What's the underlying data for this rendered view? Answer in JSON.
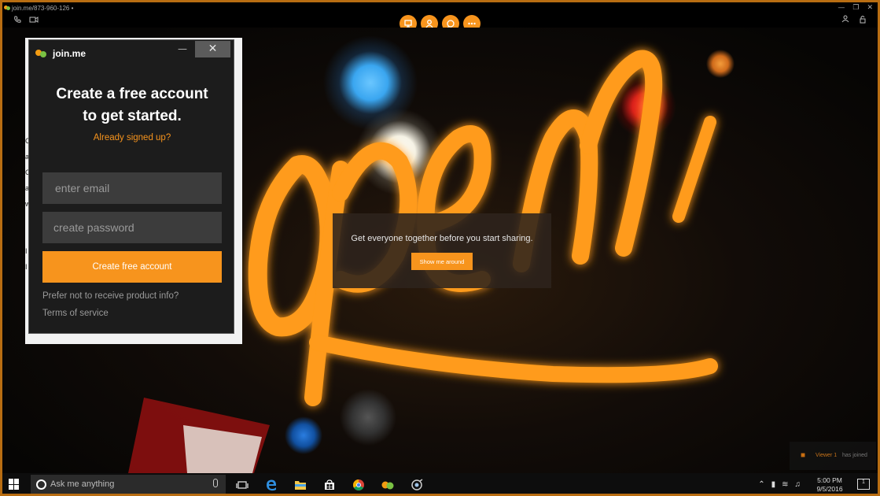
{
  "titlebar": {
    "meeting": "join.me/873-960-126 •"
  },
  "toolbar": {
    "left_icons": [
      "phone-icon",
      "video-icon"
    ],
    "center_icons": [
      "screen-share-icon",
      "people-icon",
      "chat-icon",
      "more-icon"
    ],
    "right_icons": [
      "person-icon",
      "lock-icon"
    ]
  },
  "strip_letters": [
    "C",
    "a",
    "C",
    "a",
    "w",
    "",
    "",
    "I",
    "I"
  ],
  "dialog": {
    "brand": "join.me",
    "close_label": "✕",
    "minimize_label": "—",
    "title_line1": "Create a free account",
    "title_line2": "to get started.",
    "already_signed": "Already signed up?",
    "email_placeholder": "enter email",
    "password_placeholder": "create password",
    "create_button": "Create free account",
    "prefer_not": "Prefer not to receive product info?",
    "terms": "Terms of service"
  },
  "overlay": {
    "message": "Get everyone together before you start sharing.",
    "button": "Show me around"
  },
  "viewer_notice": {
    "name": "Viewer 1",
    "rest": "has joined"
  },
  "taskbar": {
    "search_placeholder": "Ask me anything",
    "time": "5:00 PM",
    "date": "9/5/2016",
    "notification_count": "1"
  },
  "colors": {
    "accent": "#f7941d",
    "frame": "#b86d12",
    "dialog_bg": "#1c1c1c",
    "field_bg": "#3c3c3c"
  }
}
